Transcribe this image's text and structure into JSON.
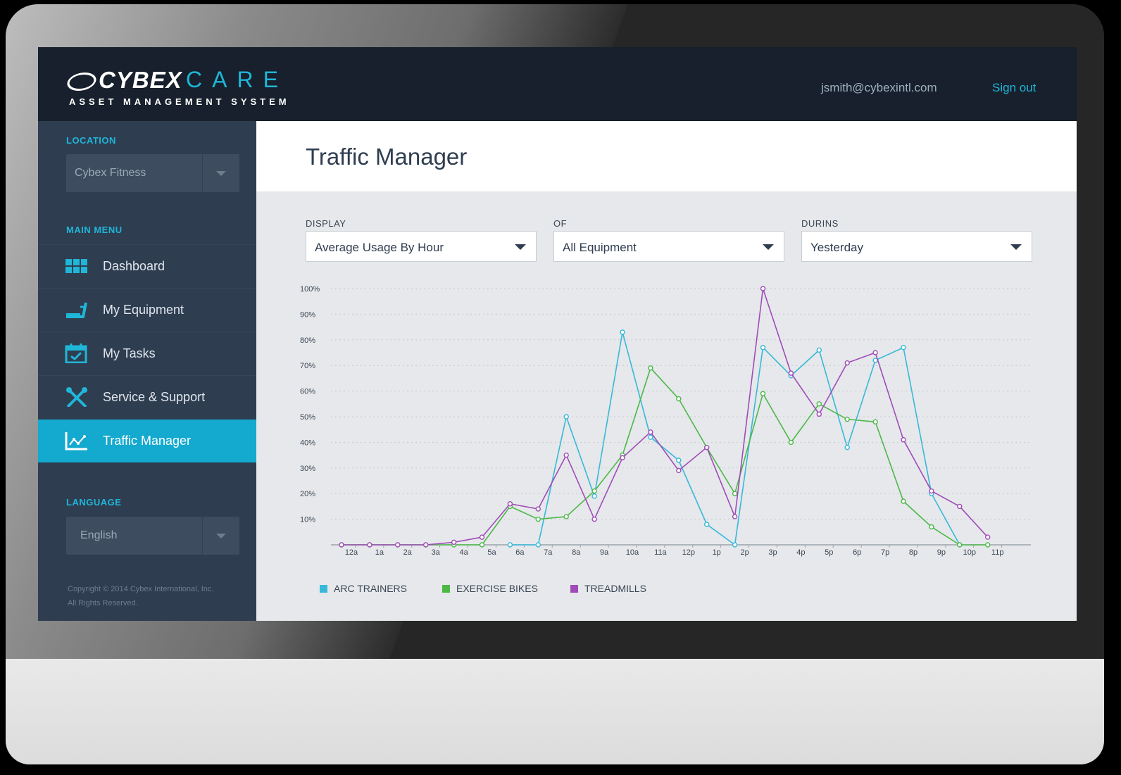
{
  "brand": {
    "logo_word": "CYBEX",
    "logo_care": "CARE",
    "logo_subtitle": "ASSET MANAGEMENT SYSTEM"
  },
  "header": {
    "user_email": "jsmith@cybexintl.com",
    "signout_label": "Sign out"
  },
  "sidebar": {
    "location_label": "LOCATION",
    "location_value": "Cybex Fitness",
    "main_menu_label": "MAIN MENU",
    "items": [
      {
        "label": "Dashboard",
        "icon": "grid-icon"
      },
      {
        "label": "My Equipment",
        "icon": "treadmill-icon"
      },
      {
        "label": "My Tasks",
        "icon": "calendar-check-icon"
      },
      {
        "label": "Service & Support",
        "icon": "tools-icon"
      },
      {
        "label": "Traffic Manager",
        "icon": "chart-icon",
        "active": true
      }
    ],
    "language_label": "LANGUAGE",
    "language_value": "English",
    "copyright_line1": "Copyright © 2014 Cybex International, Inc.",
    "copyright_line2": "All Rights Reserved."
  },
  "page": {
    "title": "Traffic Manager"
  },
  "filters": {
    "display_label": "DISPLAY",
    "display_value": "Average Usage By Hour",
    "of_label": "OF",
    "of_value": "All Equipment",
    "during_label": "DURINS",
    "during_value": "Yesterday"
  },
  "colors": {
    "accent": "#14a9cf",
    "arc": "#38b8d8",
    "bikes": "#4cb848",
    "treadmills": "#a04cb8"
  },
  "chart_data": {
    "type": "line",
    "categories": [
      "12a",
      "1a",
      "2a",
      "3a",
      "4a",
      "5a",
      "6a",
      "7a",
      "8a",
      "9a",
      "10a",
      "11a",
      "12p",
      "1p",
      "2p",
      "3p",
      "4p",
      "5p",
      "6p",
      "7p",
      "8p",
      "9p",
      "10p",
      "11p"
    ],
    "y_tick_labels": [
      "10%",
      "20%",
      "30%",
      "40%",
      "50%",
      "60%",
      "70%",
      "80%",
      "90%",
      "100%"
    ],
    "ylim": [
      0,
      100
    ],
    "grid": true,
    "legend_position": "bottom-left",
    "series": [
      {
        "name": "ARC TRAINERS",
        "color": "#38b8d8",
        "values": [
          null,
          null,
          null,
          null,
          null,
          null,
          0,
          0,
          50,
          19,
          83,
          42,
          33,
          8,
          0,
          77,
          66,
          76,
          38,
          72,
          77,
          20,
          0,
          null
        ]
      },
      {
        "name": "EXERCISE BIKES",
        "color": "#4cb848",
        "values": [
          0,
          0,
          0,
          0,
          0,
          0,
          15,
          10,
          11,
          21,
          35,
          69,
          57,
          38,
          20,
          59,
          40,
          55,
          49,
          48,
          17,
          7,
          0,
          0
        ]
      },
      {
        "name": "TREADMILLS",
        "color": "#a04cb8",
        "values": [
          0,
          0,
          0,
          0,
          1,
          3,
          16,
          14,
          35,
          10,
          34,
          44,
          29,
          38,
          11,
          100,
          67,
          51,
          71,
          75,
          41,
          21,
          15,
          3
        ]
      }
    ]
  }
}
